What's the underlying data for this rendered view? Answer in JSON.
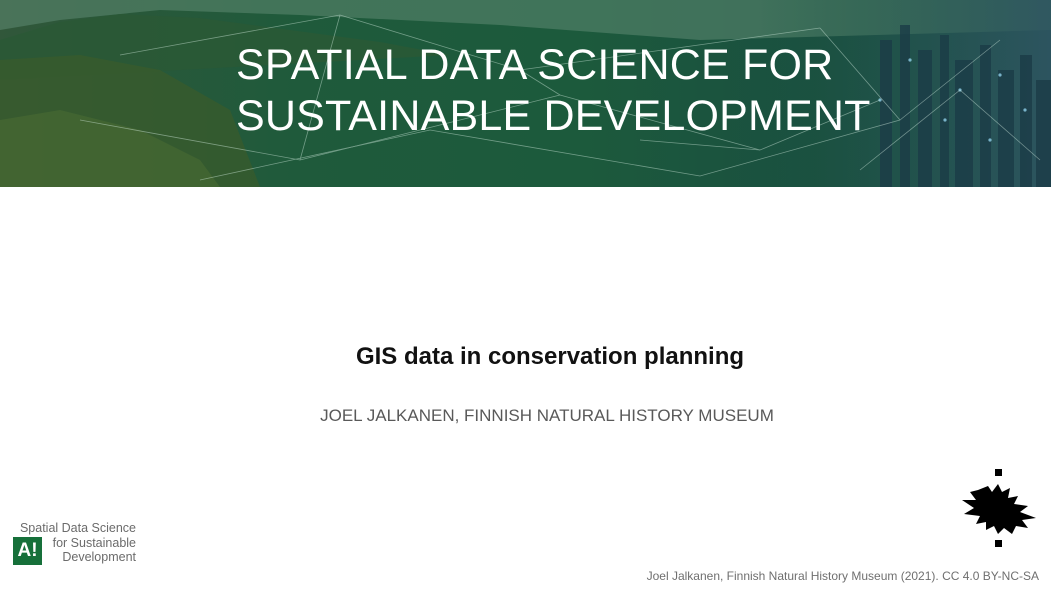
{
  "banner": {
    "title_line1": "SPATIAL DATA SCIENCE FOR",
    "title_line2": "SUSTAINABLE DEVELOPMENT"
  },
  "slide": {
    "title": "GIS data in conservation planning",
    "subtitle": "JOEL JALKANEN, FINNISH NATURAL HISTORY MUSEUM"
  },
  "logos": {
    "course_logo": {
      "badge": "A!",
      "line1": "Spatial Data Science",
      "line2": "for Sustainable",
      "line3": "Development",
      "icon": "aalto-a-logo-icon"
    },
    "university_logo": {
      "icon": "university-of-helsinki-seal-icon"
    }
  },
  "footer": {
    "credit": "Joel Jalkanen, Finnish Natural History Museum (2021). CC 4.0 BY-NC-SA"
  },
  "colors": {
    "banner_green": "#1c5a3c",
    "badge_green": "#16703a",
    "title_text": "#111111",
    "subtitle_text": "#595959"
  }
}
